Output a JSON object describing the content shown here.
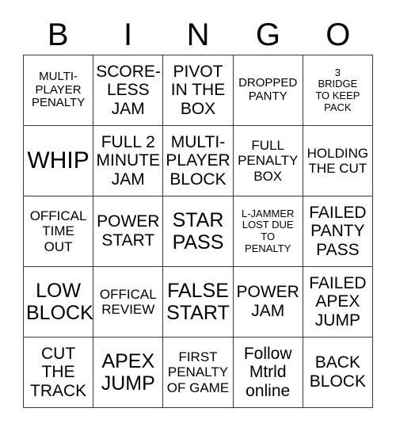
{
  "header": {
    "letters": [
      "B",
      "I",
      "N",
      "G",
      "O"
    ]
  },
  "grid": {
    "columns": 5,
    "rows": 5,
    "border_color": "#3a3a3a",
    "background_color": "#ffffff",
    "text_color": "#000000",
    "cells": [
      {
        "text": "MULTI-\nPLAYER\nPENALTY",
        "size": "s"
      },
      {
        "text": "SCORE-\nLESS\nJAM",
        "size": "l"
      },
      {
        "text": "PIVOT\nIN THE\nBOX",
        "size": "l"
      },
      {
        "text": "DROPPED\nPANTY",
        "size": "s"
      },
      {
        "text": "3\nBRIDGE\nTO KEEP\nPACK",
        "size": "xs"
      },
      {
        "text": "WHIP",
        "size": "xxl"
      },
      {
        "text": "FULL 2\nMINUTE\nJAM",
        "size": "l"
      },
      {
        "text": "MULTI-\nPLAYER\nBLOCK",
        "size": "l"
      },
      {
        "text": "FULL\nPENALTY\nBOX",
        "size": "m"
      },
      {
        "text": "HOLDING\nTHE CUT",
        "size": "m"
      },
      {
        "text": "OFFICAL\nTIME\nOUT",
        "size": "m"
      },
      {
        "text": "POWER\nSTART",
        "size": "l"
      },
      {
        "text": "STAR\nPASS",
        "size": "xl"
      },
      {
        "text": "L-JAMMER\nLOST DUE\nTO\nPENALTY",
        "size": "xs"
      },
      {
        "text": "FAILED\nPANTY\nPASS",
        "size": "l"
      },
      {
        "text": "LOW\nBLOCK",
        "size": "xl"
      },
      {
        "text": "OFFICAL\nREVIEW",
        "size": "m"
      },
      {
        "text": "FALSE\nSTART",
        "size": "xl"
      },
      {
        "text": "POWER\nJAM",
        "size": "l"
      },
      {
        "text": "FAILED\nAPEX\nJUMP",
        "size": "l"
      },
      {
        "text": "CUT\nTHE\nTRACK",
        "size": "l"
      },
      {
        "text": "APEX\nJUMP",
        "size": "xl"
      },
      {
        "text": "FIRST\nPENALTY\nOF GAME",
        "size": "m"
      },
      {
        "text": "Follow\nMtrld\nonline",
        "size": "l"
      },
      {
        "text": "BACK\nBLOCK",
        "size": "l"
      }
    ]
  }
}
